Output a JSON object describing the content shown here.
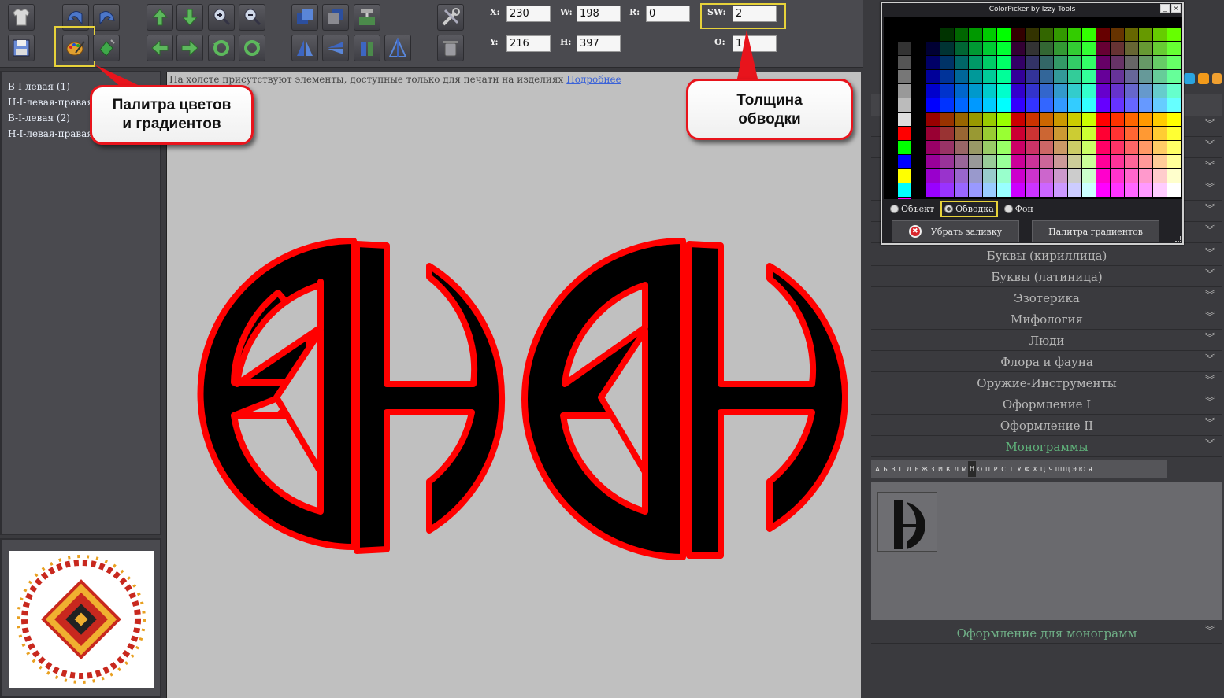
{
  "toolbar": {
    "icons": [
      "shirt-icon",
      "save-disk-icon",
      "undo-icon",
      "redo-icon",
      "palette-icon",
      "fill-bucket-icon",
      "move-up-icon",
      "move-down-icon",
      "zoom-in-icon",
      "zoom-out-icon",
      "move-left-icon",
      "move-right-icon",
      "rotate-ccw-icon",
      "rotate-cw-icon",
      "bring-front-icon",
      "send-back-icon",
      "align-icon",
      "flip-horizontal-icon",
      "flip-horizontal-2-icon",
      "flip-vertical-icon",
      "distribute-icon",
      "tools-icon",
      "trash-icon"
    ],
    "highlight_color": "#e7d23a"
  },
  "properties": {
    "x_label": "X:",
    "x_value": "230",
    "y_label": "Y:",
    "y_value": "216",
    "w_label": "W:",
    "w_value": "198",
    "h_label": "H:",
    "h_value": "397",
    "r_label": "R:",
    "r_value": "0",
    "sw_label": "SW:",
    "sw_value": "2",
    "o_label": "O:",
    "o_value": "1"
  },
  "layers": [
    "B-I-левая (1)",
    "H-I-левая-правая (1)",
    "B-I-левая (2)",
    "H-I-левая-правая (2)"
  ],
  "canvas": {
    "notice": "На холсте присутствуют элементы, доступные только для печати на изделиях",
    "notice_link": "Подробнее",
    "background": "#c0c0c0",
    "fill_color": "#000000",
    "stroke_color": "#ff0000"
  },
  "callouts": {
    "palette": "Палитра цветов\nи градиентов",
    "stroke_width": "Толщина\nобводки",
    "border_color": "#e8141c"
  },
  "colorpicker": {
    "title": "ColorPicker by Izzy Tools",
    "minimize": "_",
    "close": "×",
    "radio_object": "Объект",
    "radio_stroke": "Обводка",
    "radio_background": "Фон",
    "selected_radio": "Обводка",
    "remove_fill": "Убрать заливку",
    "gradient_palette": "Палитра градиентов"
  },
  "categories": [
    "Буквы (кириллица)",
    "Буквы (латиница)",
    "Эзотерика",
    "Мифология",
    "Люди",
    "Флора и фауна",
    "Оружие-Инструменты",
    "Оформление I",
    "Оформление II",
    "Монограммы"
  ],
  "active_category": "Монограммы",
  "bottom_category": "Оформление для монограмм",
  "alphabet": [
    "А",
    "Б",
    "В",
    "Г",
    "Д",
    "Е",
    "Ж",
    "З",
    "И",
    "К",
    "Л",
    "М",
    "Н",
    "О",
    "П",
    "Р",
    "С",
    "Т",
    "У",
    "Ф",
    "Х",
    "Ц",
    "Ч",
    "Ш",
    "Щ",
    "Э",
    "Ю",
    "Я"
  ],
  "alphabet_selected": "Н",
  "chevron": "︾"
}
